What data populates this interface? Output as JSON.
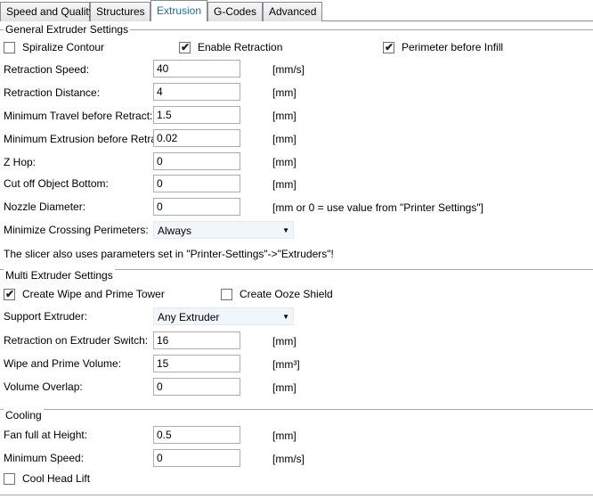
{
  "tabs": [
    {
      "label": "Speed and Quality",
      "active": false
    },
    {
      "label": "Structures",
      "active": false
    },
    {
      "label": "Extrusion",
      "active": true
    },
    {
      "label": "G-Codes",
      "active": false
    },
    {
      "label": "Advanced",
      "active": false
    }
  ],
  "general": {
    "title": "General Extruder Settings",
    "spiralize": {
      "label": "Spiralize Contour",
      "checked": false
    },
    "enable_retraction": {
      "label": "Enable Retraction",
      "checked": true
    },
    "perimeter_before_infill": {
      "label": "Perimeter before Infill",
      "checked": true
    },
    "retraction_speed": {
      "label": "Retraction Speed:",
      "value": "40",
      "unit": "[mm/s]"
    },
    "retraction_distance": {
      "label": "Retraction Distance:",
      "value": "4",
      "unit": "[mm]"
    },
    "min_travel": {
      "label": "Minimum Travel before Retract:",
      "value": "1.5",
      "unit": "[mm]"
    },
    "min_extrusion": {
      "label": "Minimum Extrusion before Retract:",
      "value": "0.02",
      "unit": "[mm]"
    },
    "z_hop": {
      "label": "Z Hop:",
      "value": "0",
      "unit": "[mm]"
    },
    "cut_off_bottom": {
      "label": "Cut off Object Bottom:",
      "value": "0",
      "unit": "[mm]"
    },
    "nozzle_diameter": {
      "label": "Nozzle Diameter:",
      "value": "0",
      "unit": "[mm or 0 = use value from \"Printer Settings\"]"
    },
    "min_crossing": {
      "label": "Minimize Crossing Perimeters:",
      "value": "Always"
    },
    "note": "The slicer also uses parameters set in \"Printer-Settings\"->\"Extruders\"!"
  },
  "multi": {
    "title": "Multi Extruder Settings",
    "wipe_tower": {
      "label": "Create Wipe and Prime Tower",
      "checked": true
    },
    "ooze_shield": {
      "label": "Create Ooze Shield",
      "checked": false
    },
    "support_extruder": {
      "label": "Support Extruder:",
      "value": "Any Extruder"
    },
    "retraction_switch": {
      "label": "Retraction on Extruder Switch:",
      "value": "16",
      "unit": "[mm]"
    },
    "wipe_volume": {
      "label": "Wipe and Prime Volume:",
      "value": "15",
      "unit": "[mm³]"
    },
    "volume_overlap": {
      "label": "Volume Overlap:",
      "value": "0",
      "unit": "[mm]"
    }
  },
  "cooling": {
    "title": "Cooling",
    "fan_full": {
      "label": "Fan full at Height:",
      "value": "0.5",
      "unit": "[mm]"
    },
    "min_speed": {
      "label": "Minimum Speed:",
      "value": "0",
      "unit": "[mm/s]"
    },
    "cool_head_lift": {
      "label": "Cool Head Lift",
      "checked": false
    }
  }
}
